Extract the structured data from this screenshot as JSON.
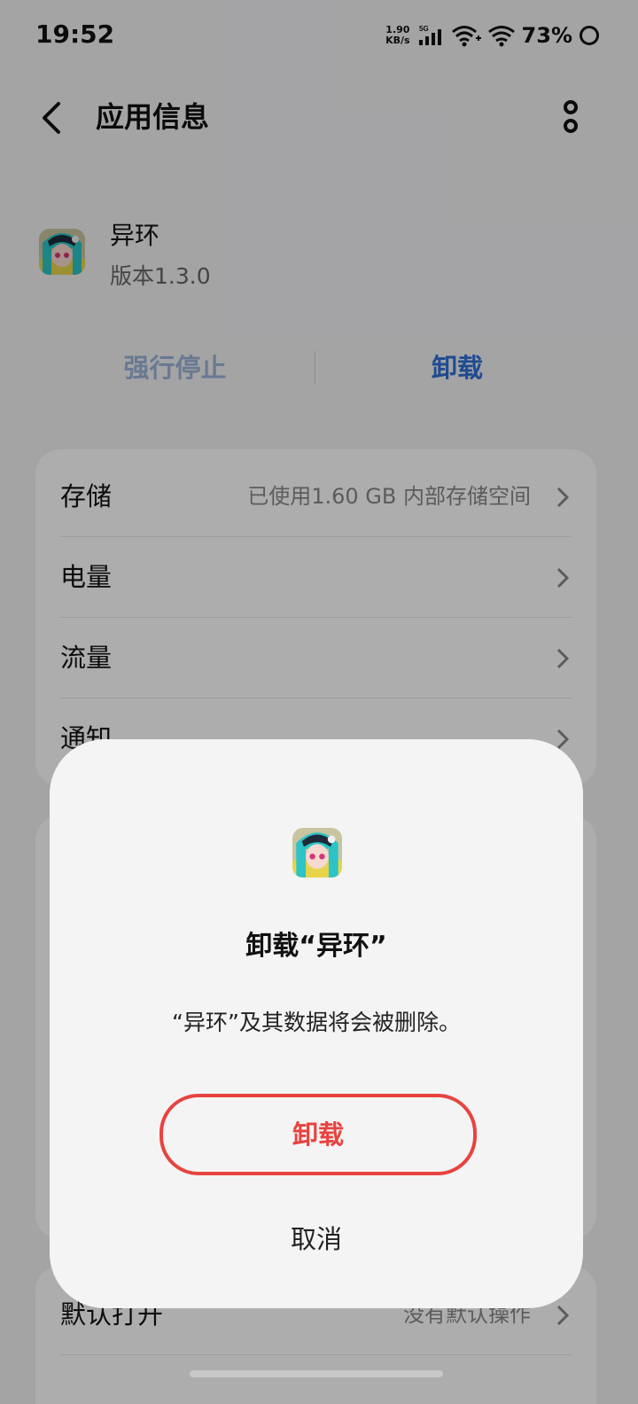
{
  "status_bar": {
    "time": "19:52",
    "net_speed_value": "1.90",
    "net_speed_unit": "KB/s",
    "network_type": "5G",
    "battery": "73%"
  },
  "header": {
    "title": "应用信息"
  },
  "app": {
    "name": "异环",
    "version": "版本1.3.0"
  },
  "actions": {
    "force_stop": "强行停止",
    "uninstall": "卸载"
  },
  "settings": [
    {
      "label": "存储",
      "value": "已使用1.60 GB 内部存储空间"
    },
    {
      "label": "电量",
      "value": ""
    },
    {
      "label": "流量",
      "value": ""
    },
    {
      "label": "通知",
      "value": ""
    }
  ],
  "lower_settings": [
    {
      "label": "默认打开",
      "value": "没有默认操作"
    }
  ],
  "dialog": {
    "title": "卸载“异环”",
    "message": "“异环”及其数据将会被删除。",
    "confirm": "卸载",
    "cancel": "取消"
  },
  "colors": {
    "accent_blue": "#2f6fd6",
    "danger_red": "#e8433f"
  }
}
